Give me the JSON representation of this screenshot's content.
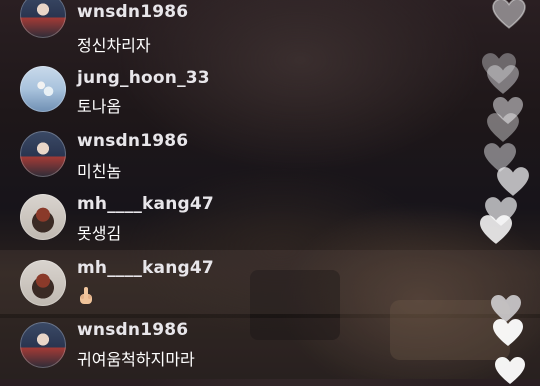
{
  "comments": [
    {
      "username": "wnsdn1986",
      "message": "정신차리자",
      "avatar": "player-avatar"
    },
    {
      "username": "jung_hoon_33",
      "message": "토나옴",
      "avatar": "team-photo-avatar"
    },
    {
      "username": "wnsdn1986",
      "message": "미친놈",
      "avatar": "player-avatar"
    },
    {
      "username": "mh____kang47",
      "message": "못생김",
      "avatar": "mascot-avatar"
    },
    {
      "username": "mh____kang47",
      "message": "",
      "emoji": "middle-finger-emoji",
      "avatar": "mascot-avatar"
    },
    {
      "username": "wnsdn1986",
      "message": "귀여움척하지마라",
      "avatar": "player-avatar"
    }
  ],
  "icons": {
    "heart": "heart-icon",
    "heart_color": "#ffffff"
  }
}
